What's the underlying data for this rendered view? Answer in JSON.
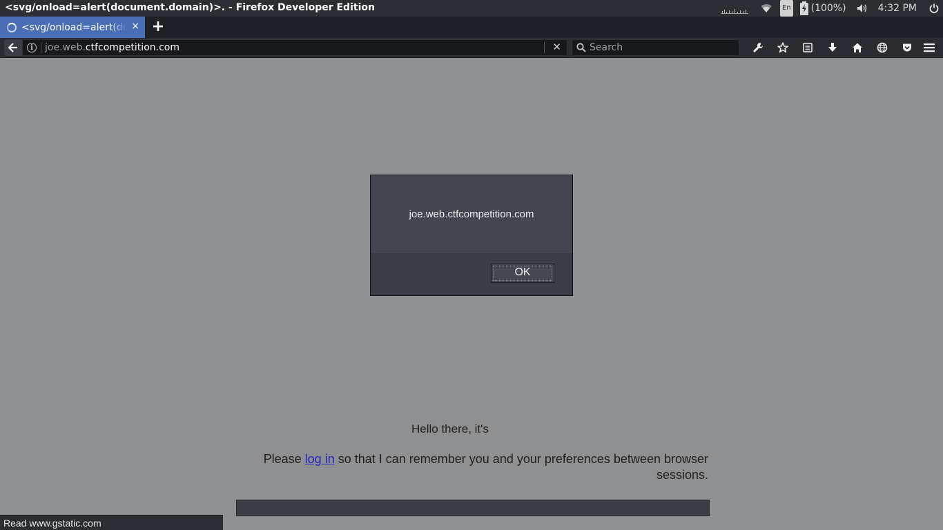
{
  "os_panel": {
    "window_title": "<svg/onload=alert(document.domain)>. - Firefox Developer Edition",
    "keyboard_layout": "En",
    "battery": "(100%)",
    "clock": "4:32 PM"
  },
  "tab": {
    "title": "<svg/onload=alert(document.domain)>",
    "close_glyph": "×",
    "new_tab_glyph": "+"
  },
  "nav": {
    "url_prefix": "joe.web.",
    "url_host": "ctfcompetition.com",
    "search_placeholder": "Search",
    "clear_glyph": "✕"
  },
  "toolbar_icons": [
    "wrench-icon",
    "star-icon",
    "reader-list-icon",
    "download-icon",
    "home-icon",
    "globe-icon",
    "pocket-icon",
    "hamburger-menu-icon"
  ],
  "page": {
    "greeting": "Hello there, it's",
    "login_before": "Please ",
    "login_link": "log in",
    "login_after": " so that I can remember you and your preferences between browser sessions."
  },
  "status_bar": {
    "text": "Read www.gstatic.com"
  },
  "dialog": {
    "message": "joe.web.ctfcompetition.com",
    "ok_label": "OK"
  },
  "colors": {
    "tab_active": "#4a6eb5",
    "page_bg": "#8f9092",
    "link": "#2323b8",
    "dialog_bg": "#434651"
  }
}
